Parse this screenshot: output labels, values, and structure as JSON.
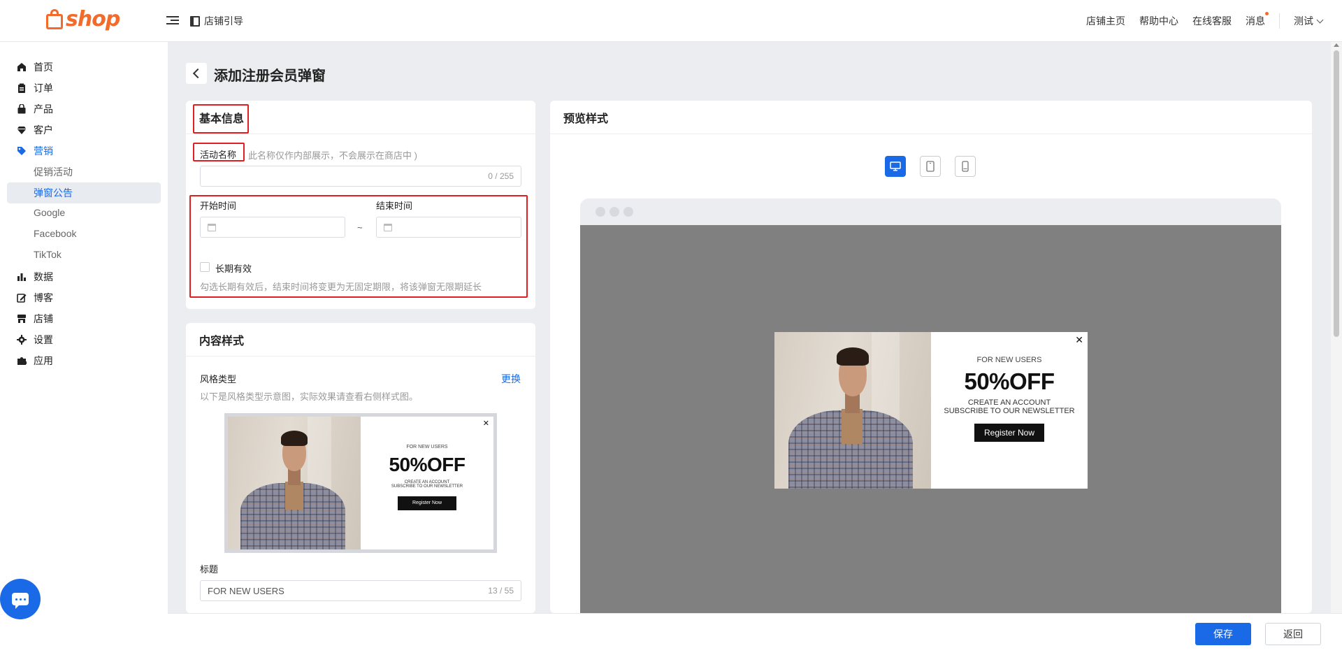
{
  "header": {
    "logo_text": "shop",
    "guide_label": "店铺引导",
    "links": [
      "店铺主页",
      "帮助中心",
      "在线客服",
      "消息"
    ],
    "user": "测试"
  },
  "sidebar": {
    "items": [
      {
        "label": "首页",
        "icon": "home-icon"
      },
      {
        "label": "订单",
        "icon": "clipboard-icon"
      },
      {
        "label": "产品",
        "icon": "bag-icon"
      },
      {
        "label": "客户",
        "icon": "diamond-icon"
      },
      {
        "label": "营销",
        "icon": "tag-icon"
      },
      {
        "label": "数据",
        "icon": "bar-chart-icon"
      },
      {
        "label": "博客",
        "icon": "edit-icon"
      },
      {
        "label": "店铺",
        "icon": "store-icon"
      },
      {
        "label": "设置",
        "icon": "gear-icon"
      },
      {
        "label": "应用",
        "icon": "puzzle-icon"
      }
    ],
    "marketing_sub": [
      "促销活动",
      "弹窗公告",
      "Google",
      "Facebook",
      "TikTok"
    ],
    "active_item": "营销",
    "active_sub": "弹窗公告"
  },
  "page": {
    "title": "添加注册会员弹窗"
  },
  "basic_info": {
    "title": "基本信息",
    "name_label": "活动名称",
    "name_hint": "此名称仅作内部展示，不会展示在商店中 )",
    "name_value": "",
    "name_counter": "0 / 255",
    "start_label": "开始时间",
    "end_label": "结束时间",
    "range_sep": "~",
    "long_term_label": "长期有效",
    "long_term_checked": false,
    "long_term_hint": "勾选长期有效后，结束时间将变更为无固定期限，将该弹窗无限期延长"
  },
  "content_style": {
    "title": "内容样式",
    "style_type_label": "风格类型",
    "change_link": "更换",
    "style_hint": "以下是风格类型示意图，实际效果请查看右侧样式图。",
    "title_label": "标题",
    "title_value": "FOR NEW USERS",
    "title_counter": "13 / 55"
  },
  "popup": {
    "close": "✕",
    "subtitle": "FOR NEW USERS",
    "headline": "50%OFF",
    "line1": "CREATE AN ACCOUNT",
    "line2": "SUBSCRIBE TO OUR NEWSLETTER",
    "button": "Register Now"
  },
  "preview": {
    "title": "预览样式",
    "devices": [
      "desktop-icon",
      "tablet-icon",
      "mobile-icon"
    ],
    "active_device": "desktop-icon"
  },
  "footer": {
    "save": "保存",
    "back": "返回"
  },
  "colors": {
    "accent": "#1a6ae8",
    "brand": "#f26b2a",
    "highlight_box": "#e02020",
    "preview_stage": "#808080"
  }
}
